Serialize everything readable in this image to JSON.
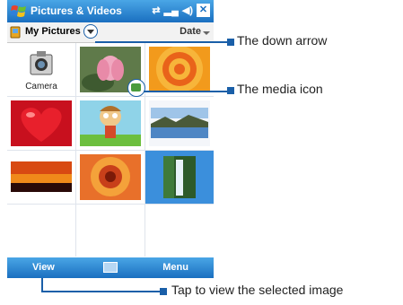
{
  "titlebar": {
    "title": "Pictures & Videos",
    "status_icons": [
      "sync-icon",
      "signal-icon",
      "volume-icon",
      "close-icon"
    ],
    "close_label": "✕"
  },
  "folderbar": {
    "folder_label": "My Pictures",
    "sort_label": "Date"
  },
  "grid": {
    "items": [
      {
        "label": "Camera",
        "kind": "camera"
      },
      {
        "label": "",
        "kind": "lotus"
      },
      {
        "label": "",
        "kind": "orange-rings"
      },
      {
        "label": "",
        "kind": "red-heart"
      },
      {
        "label": "",
        "kind": "cartoon"
      },
      {
        "label": "",
        "kind": "lake"
      },
      {
        "label": "",
        "kind": "sunset"
      },
      {
        "label": "",
        "kind": "flower-closeup"
      },
      {
        "label": "",
        "kind": "waterfall",
        "selected": true
      }
    ]
  },
  "menubar": {
    "left": "View",
    "right": "Menu"
  },
  "callouts": {
    "down_arrow": "The down arrow",
    "media_icon": "The media icon",
    "view": "Tap to view the selected image"
  },
  "colors": {
    "titlebar": "#1a6fc0",
    "selection": "#3b8fdc",
    "callout": "#1a5fa8"
  }
}
